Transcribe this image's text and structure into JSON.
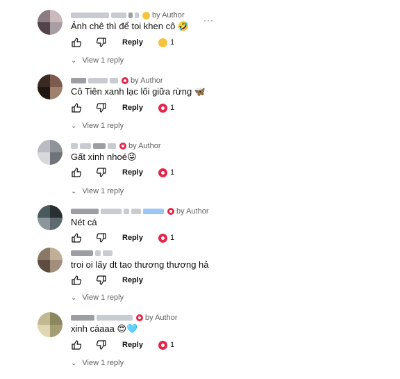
{
  "comments": [
    {
      "text": "Ảnh chê thì để toi khen cô 🤣",
      "author_tag": "by Author",
      "reply_label": "Reply",
      "reaction_count": "1",
      "reaction": "laugh",
      "view_replies": "View 1 reply",
      "avatar_colors": [
        "#8a7c82",
        "#c9b8bc",
        "#514349",
        "#a89da3"
      ]
    },
    {
      "text": "Cô Tiên xanh lạc lối giữa rừng 🦋",
      "author_tag": "by Author",
      "reply_label": "Reply",
      "reaction_count": "1",
      "reaction": "heart",
      "view_replies": "View 1 reply",
      "avatar_colors": [
        "#3b2a24",
        "#7c5a4d",
        "#1f1612",
        "#a0806f"
      ]
    },
    {
      "text": "Gất xinh nhoé😜",
      "author_tag": "by Author",
      "reply_label": "Reply",
      "reaction_count": "1",
      "reaction": "heart",
      "view_replies": "View 1 reply",
      "avatar_colors": [
        "#b9bcc2",
        "#8f949b",
        "#d6d8dc",
        "#6f747b"
      ]
    },
    {
      "text": "Nét cá",
      "author_tag": "by Author",
      "reply_label": "Reply",
      "reaction_count": "1",
      "reaction": "heart",
      "view_replies": "",
      "avatar_colors": [
        "#4a5a5c",
        "#2a2f33",
        "#8a9699",
        "#5d6b6e"
      ]
    },
    {
      "text": "troi oi lấy dt tao thương thương hả",
      "author_tag": "",
      "reply_label": "Reply",
      "reaction_count": "",
      "reaction": "",
      "view_replies": "View 1 reply",
      "avatar_colors": [
        "#8a7866",
        "#c2ad97",
        "#5e4d3f",
        "#a18f7c"
      ]
    },
    {
      "text": "xinh cáaaa 😍🩵",
      "author_tag": "by Author",
      "reply_label": "Reply",
      "reaction_count": "1",
      "reaction": "heart",
      "view_replies": "View 1 reply",
      "avatar_colors": [
        "#c2b892",
        "#8d875f",
        "#e0d7b0",
        "#a59d74"
      ]
    }
  ],
  "icons": {
    "like": "thumbs-up-icon",
    "dislike": "thumbs-down-icon",
    "more": "more-options-icon",
    "chevron": "chevron-down-icon"
  },
  "more_label": "···"
}
